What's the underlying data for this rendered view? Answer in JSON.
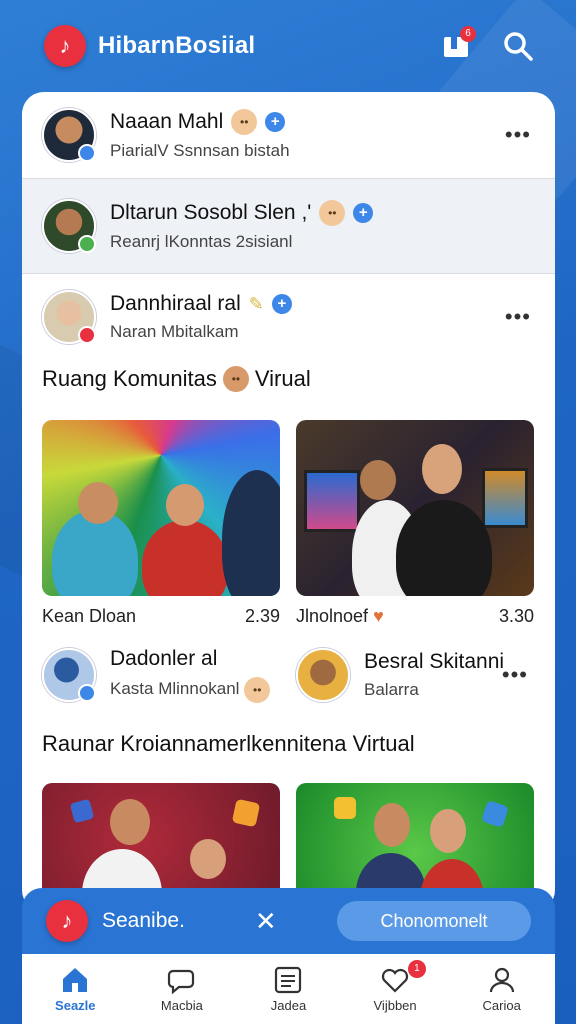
{
  "app": {
    "title": "HibarnBosiial",
    "notification_count": "6"
  },
  "rows": [
    {
      "name": "Naaan Mahl",
      "sub": "PiarialV Ssnnsan bistah"
    },
    {
      "name": "Dltarun Sosobl Slen ,'",
      "sub": "Reanrj lKonntas 2sisianl"
    },
    {
      "name": "Dannhiraal ral",
      "sub": "Naran Mbitalkam"
    }
  ],
  "section1": {
    "title": "Ruang Komunitas",
    "title_suffix": "Virual"
  },
  "tiles1": [
    {
      "name": "Kean Dloan",
      "value": "2.39"
    },
    {
      "name": "Jlnolnoef",
      "value": "3.30"
    }
  ],
  "mini_users": [
    {
      "name": "Dadonler al",
      "sub": "Kasta Mlinnokanl"
    },
    {
      "name": "Besral Skitanni",
      "sub": "Balarra"
    }
  ],
  "section2": {
    "title": "Raunar Kroiannamerlkennitena Virtual"
  },
  "float_bar": {
    "title": "Seanibe.",
    "close": "✕",
    "button": "Chonomonelt"
  },
  "tabs": [
    {
      "label": "Seazle"
    },
    {
      "label": "Macbia"
    },
    {
      "label": "Jadea"
    },
    {
      "label": "Vijbben",
      "badge": "1"
    },
    {
      "label": "Carioa"
    }
  ],
  "colors": {
    "accent": "#2a75d4",
    "brand": "#e8303f",
    "verified": "#3c87e8"
  }
}
